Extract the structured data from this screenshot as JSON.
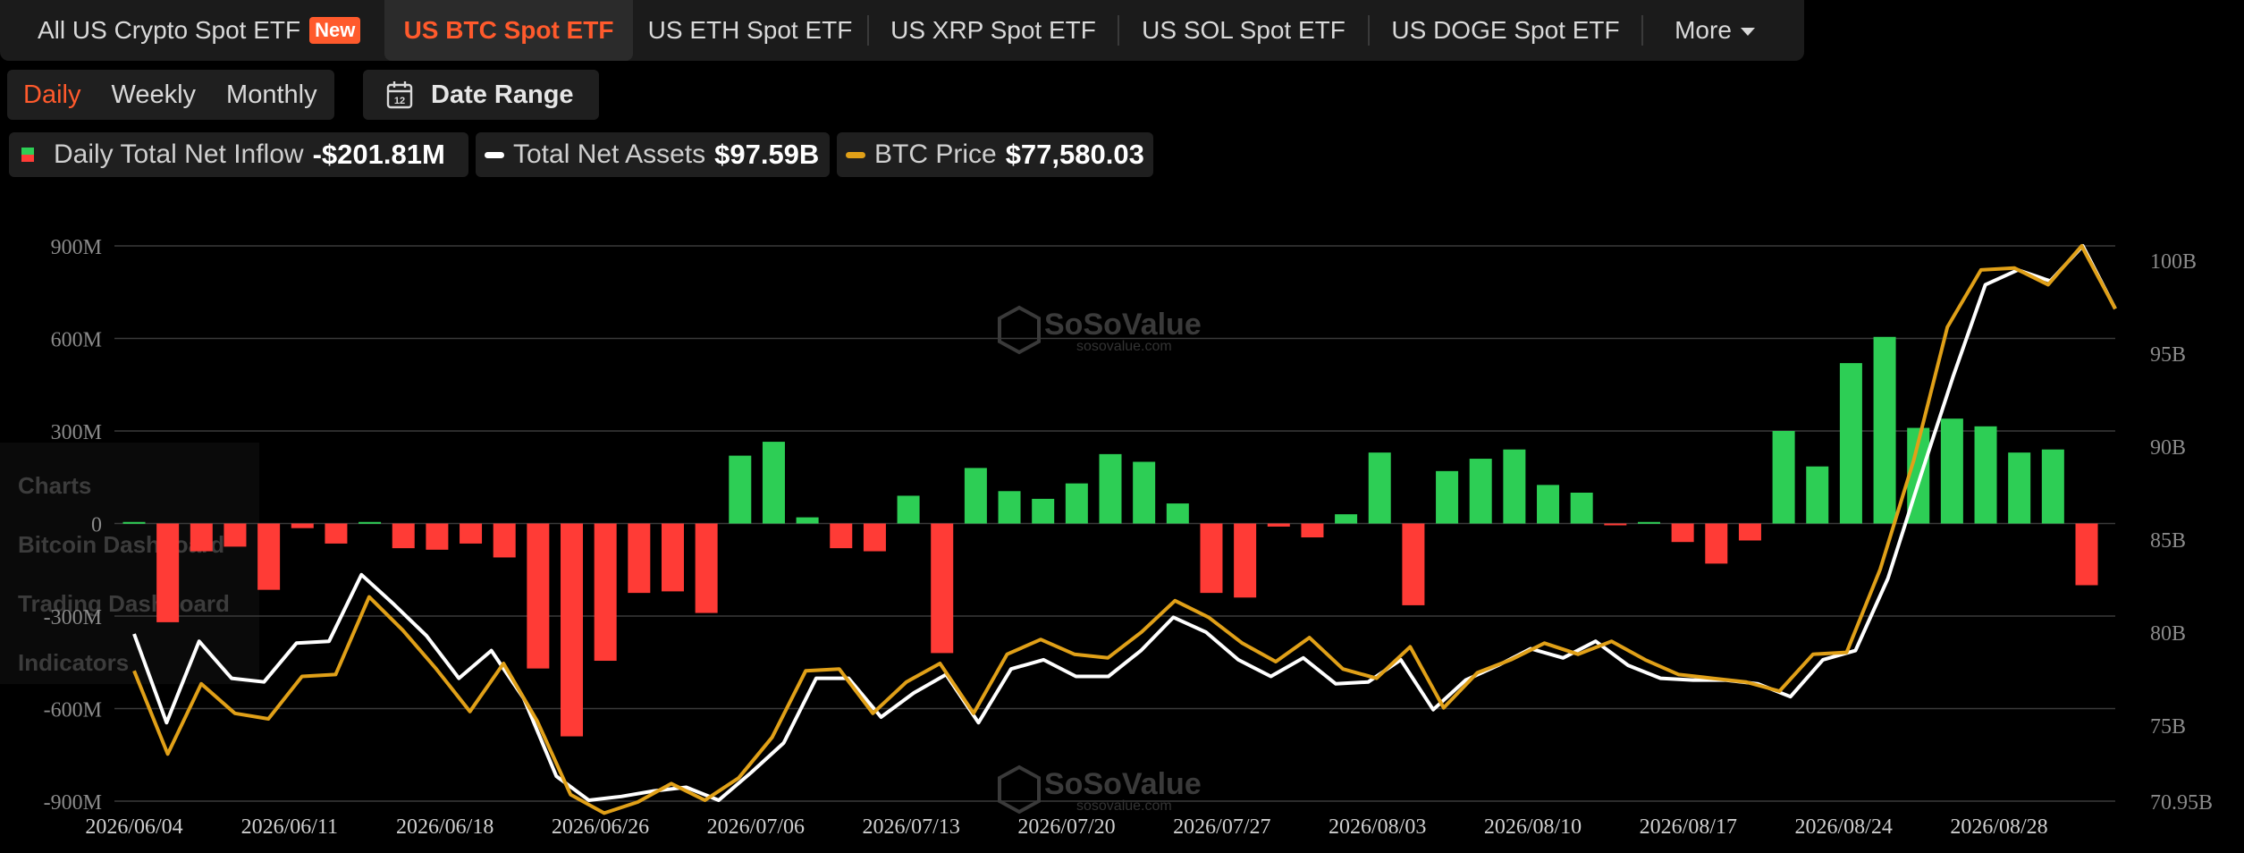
{
  "tabs": [
    {
      "label": "All US Crypto Spot ETF",
      "badge": "New"
    },
    {
      "label": "US BTC Spot ETF"
    },
    {
      "label": "US ETH Spot ETF"
    },
    {
      "label": "US XRP Spot ETF"
    },
    {
      "label": "US SOL Spot ETF"
    },
    {
      "label": "US DOGE Spot ETF"
    },
    {
      "label": "More"
    }
  ],
  "period": {
    "daily": "Daily",
    "weekly": "Weekly",
    "monthly": "Monthly",
    "selected": "Daily"
  },
  "date_range": {
    "label": "Date Range",
    "icon_text": "12"
  },
  "legend": {
    "inflow_label": "Daily Total Net Inflow",
    "inflow_value": "-$201.81M",
    "assets_label": "Total Net Assets",
    "assets_value": "$97.59B",
    "price_label": "BTC Price",
    "price_value": "$77,580.03"
  },
  "watermark": {
    "brand": "SoSoValue",
    "url": "sosovalue.com"
  },
  "ghost_sidebar": [
    "Charts",
    "Bitcoin Dashboard",
    "Trading Dashboard",
    "Indicators"
  ],
  "colors": {
    "positive": "#2dce55",
    "negative": "#ff3b36",
    "assets": "#ffffff",
    "price": "#e0a018",
    "accent": "#ff5a2c"
  },
  "chart_data": {
    "type": "bar",
    "categories": [
      "2026/06/04",
      "2026/06/11",
      "2026/06/18",
      "2026/06/26",
      "2026/07/06",
      "2026/07/13",
      "2026/07/20",
      "2026/07/27",
      "2026/08/03",
      "2026/08/10",
      "2026/08/17",
      "2026/08/24",
      "2026/08/28"
    ],
    "y_left": {
      "ticks": [
        "900M",
        "600M",
        "300M",
        "0",
        "-300M",
        "-600M",
        "-900M"
      ],
      "range": [
        -900,
        900
      ]
    },
    "y_right": {
      "ticks": [
        "100B",
        "95B",
        "90B",
        "85B",
        "80B",
        "75B",
        "70.95B"
      ],
      "range": [
        70.95,
        101
      ]
    },
    "inflow_bars": [
      5,
      -320,
      -90,
      -75,
      -215,
      -15,
      -65,
      5,
      -80,
      -85,
      -65,
      -110,
      -470,
      -690,
      -445,
      -225,
      -220,
      -290,
      220,
      265,
      20,
      -80,
      -90,
      90,
      -420,
      180,
      105,
      80,
      130,
      225,
      200,
      65,
      -225,
      -240,
      -10,
      -45,
      30,
      230,
      -265,
      170,
      210,
      240,
      125,
      100,
      -5,
      5,
      -60,
      -130,
      -55,
      300,
      185,
      520,
      605,
      310,
      340,
      315,
      230,
      240,
      -200
    ],
    "net_assets_b": [
      80.0,
      75.2,
      79.6,
      77.6,
      77.4,
      79.5,
      79.6,
      83.2,
      81.6,
      79.9,
      77.6,
      79.1,
      76.5,
      72.3,
      71.0,
      71.2,
      71.5,
      71.7,
      71.0,
      72.5,
      74.1,
      77.6,
      77.6,
      75.5,
      76.8,
      77.8,
      75.2,
      78.1,
      78.6,
      77.7,
      77.7,
      79.1,
      80.9,
      80.1,
      78.6,
      77.7,
      78.7,
      77.3,
      77.4,
      78.6,
      75.9,
      77.5,
      78.3,
      79.2,
      78.7,
      79.6,
      78.3,
      77.6,
      77.5,
      77.5,
      77.3,
      76.6,
      78.6,
      79.1,
      83.0,
      88.5,
      93.9,
      98.9,
      99.7,
      99.1,
      101.0,
      97.6
    ],
    "btc_price_b": [
      78.0,
      73.5,
      77.3,
      75.7,
      75.4,
      77.7,
      77.8,
      82.0,
      80.2,
      78.1,
      75.8,
      78.4,
      75.3,
      71.3,
      70.3,
      70.9,
      71.9,
      71.0,
      72.2,
      74.4,
      78.0,
      78.1,
      75.7,
      77.4,
      78.4,
      75.7,
      78.9,
      79.7,
      78.9,
      78.7,
      80.1,
      81.8,
      80.9,
      79.5,
      78.5,
      79.8,
      78.1,
      77.6,
      79.3,
      76.0,
      77.9,
      78.6,
      79.5,
      78.9,
      79.6,
      78.6,
      77.8,
      77.6,
      77.4,
      76.9,
      78.9,
      79.0,
      83.5,
      89.4,
      96.6,
      99.7,
      99.8,
      98.9,
      101.0,
      97.6
    ],
    "grid": true
  }
}
